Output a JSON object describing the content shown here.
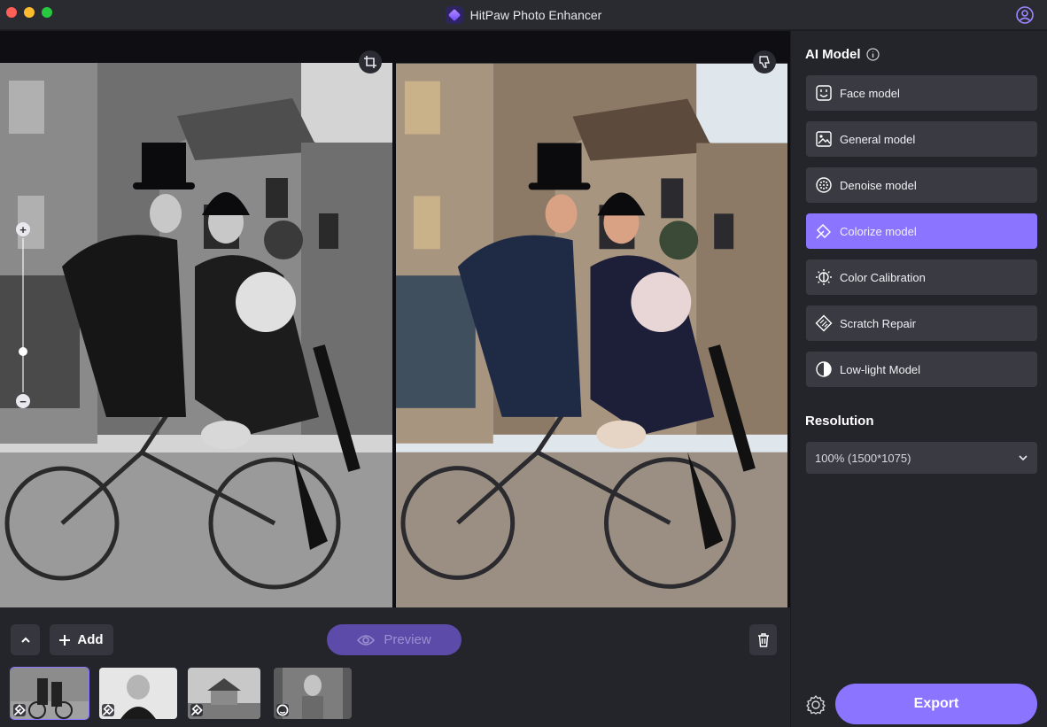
{
  "window": {
    "title": "HitPaw Photo Enhancer",
    "traffic_lights": [
      "#fe5f57",
      "#febc2e",
      "#28c840"
    ],
    "accent_color": "#8b74ff",
    "icons": [
      "app-logo",
      "user-icon"
    ]
  },
  "canvas": {
    "icons": [
      "crop-icon",
      "dislike-icon",
      "zoom-in-icon",
      "zoom-out-icon"
    ],
    "zoom_level": 0.25
  },
  "bottom_bar": {
    "add_label": "Add",
    "preview_label": "Preview",
    "thumbnail_badges": [
      "colorize-icon",
      "colorize-icon",
      "colorize-icon",
      "face-icon"
    ]
  },
  "sidebar": {
    "ai_model_title": "AI Model",
    "models": [
      {
        "label": "Face model",
        "icon": "face-icon"
      },
      {
        "label": "General model",
        "icon": "image-icon"
      },
      {
        "label": "Denoise model",
        "icon": "denoise-icon"
      },
      {
        "label": "Colorize model",
        "icon": "colorize-icon",
        "active": true
      },
      {
        "label": "Color Calibration",
        "icon": "calibration-icon"
      },
      {
        "label": "Scratch Repair",
        "icon": "scratch-icon"
      },
      {
        "label": "Low-light Model",
        "icon": "lowlight-icon"
      }
    ],
    "resolution_title": "Resolution",
    "resolution_value": "100% (1500*1075)",
    "export_label": "Export"
  }
}
